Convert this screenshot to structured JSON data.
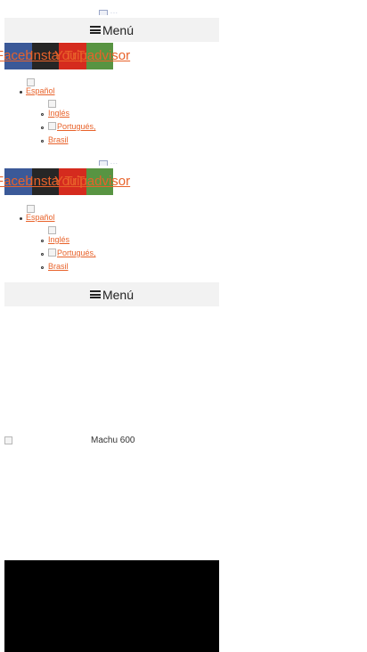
{
  "header_top": {
    "logo_alt": "...",
    "menu_label": "Menú",
    "social": [
      "Facebook",
      "Instagram",
      "YouTube",
      "Tripadvisor"
    ],
    "languages": {
      "current": "Español",
      "options": [
        "Inglés",
        "Portugués,",
        "Brasil"
      ]
    }
  },
  "header_sticky": {
    "logo_alt": "...",
    "social": [
      "Facebook",
      "Instagram",
      "YouTube",
      "Tripadvisor"
    ],
    "languages": {
      "current": "Español",
      "options": [
        "Inglés",
        "Portugués,",
        "Brasil"
      ]
    },
    "menu_label": "Menú"
  },
  "hero": {
    "image_alt": "Machu 600"
  },
  "colors": {
    "link": "#e8622a",
    "facebook": "#3b5998",
    "instagram": "#262626",
    "youtube": "#d52b1e",
    "tripadvisor": "#589442",
    "menu_bg": "#f2f2f2"
  }
}
